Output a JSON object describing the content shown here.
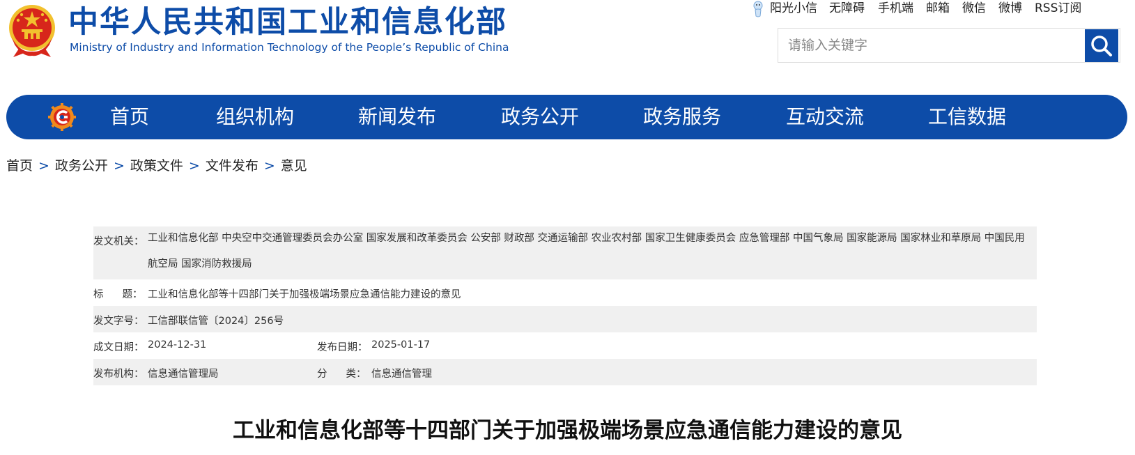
{
  "header": {
    "title": "中华人民共和国工业和信息化部",
    "subtitle": "Ministry of Industry and Information Technology of the People’s Republic of China"
  },
  "top_links": [
    "阳光小信",
    "无障碍",
    "手机端",
    "邮箱",
    "微信",
    "微博",
    "RSS订阅"
  ],
  "search": {
    "placeholder": "请输入关键字",
    "icon": "search-icon"
  },
  "nav": {
    "items": [
      "首页",
      "组织机构",
      "新闻发布",
      "政务公开",
      "政务服务",
      "互动交流",
      "工信数据"
    ]
  },
  "breadcrumb": {
    "items": [
      "首页",
      "政务公开",
      "政策文件",
      "文件发布",
      "意见"
    ],
    "separator": ">"
  },
  "meta": {
    "issuer_label": "发文机关：",
    "issuer_value": "工业和信息化部 中央空中交通管理委员会办公室 国家发展和改革委员会 公安部 财政部 交通运输部 农业农村部 国家卫生健康委员会 应急管理部 中国气象局 国家能源局 国家林业和草原局 中国民用航空局 国家消防救援局",
    "title_label_chars": "标题",
    "title_label_colon": "：",
    "title_value": "工业和信息化部等十四部门关于加强极端场景应急通信能力建设的意见",
    "doc_no_label": "发文字号：",
    "doc_no_value": "工信部联信管〔2024〕256号",
    "written_date_label": "成文日期：",
    "written_date_value": "2024-12-31",
    "publish_date_label": "发布日期：",
    "publish_date_value": "2025-01-17",
    "publisher_label": "发布机构：",
    "publisher_value": "信息通信管理局",
    "category_label_chars": "分类",
    "category_label_colon": "：",
    "category_value": "信息通信管理"
  },
  "article": {
    "title": "工业和信息化部等十四部门关于加强极端场景应急通信能力建设的意见"
  },
  "colors": {
    "brand_blue": "#0d4ca8",
    "emblem_red": "#d7261b",
    "emblem_gold": "#f2c12e",
    "row_shade": "#f0f0f0"
  }
}
